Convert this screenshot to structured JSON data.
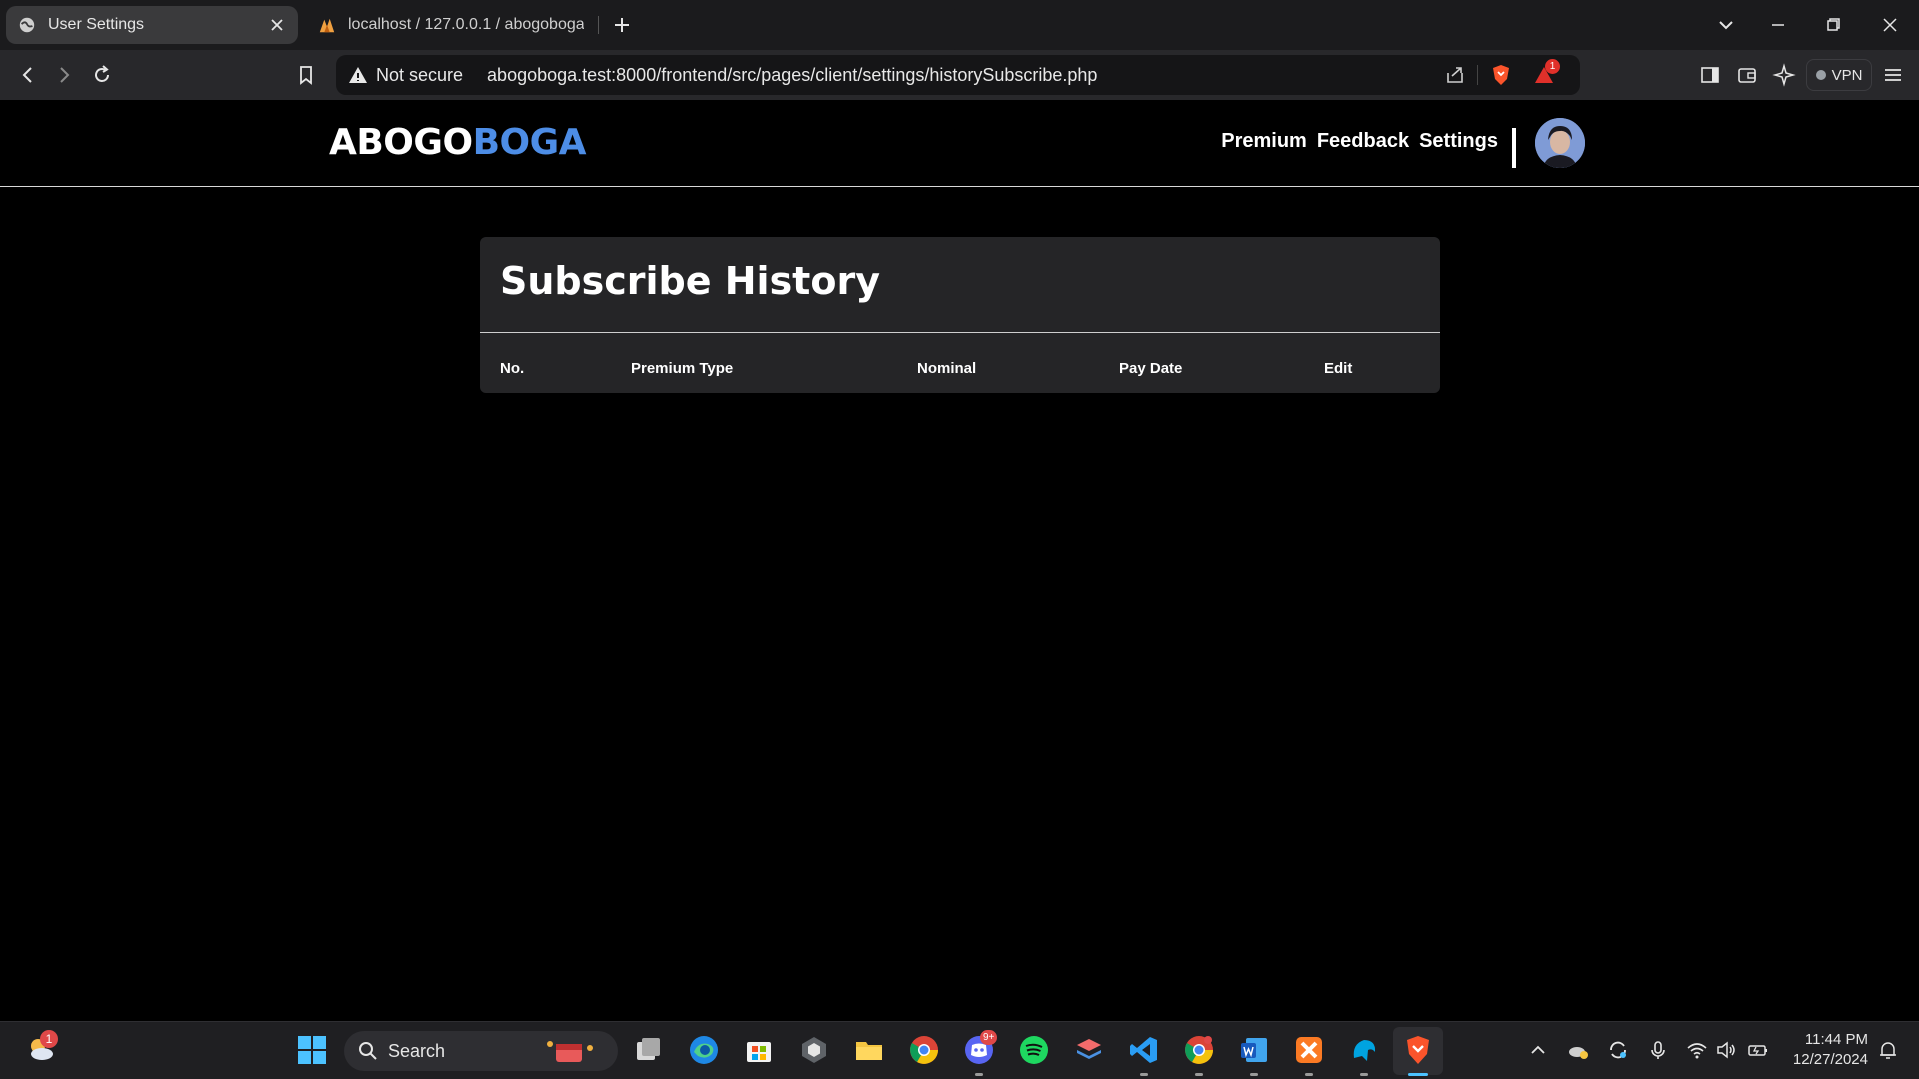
{
  "browser": {
    "tabs": [
      {
        "title": "User Settings",
        "active": true
      },
      {
        "title": "localhost / 127.0.0.1 / abogoboga /",
        "active": false
      }
    ],
    "not_secure_label": "Not secure",
    "url": "abogoboga.test:8000/frontend/src/pages/client/settings/historySubscribe.php",
    "vpn_label": "VPN",
    "shields_badge": "1"
  },
  "site": {
    "logo_part1": "ABOGO",
    "logo_part2": "BOGA",
    "nav": {
      "premium": "Premium",
      "feedback": "Feedback",
      "settings": "Settings"
    }
  },
  "card": {
    "title": "Subscribe History",
    "columns": [
      "No.",
      "Premium Type",
      "Nominal",
      "Pay Date",
      "Edit"
    ],
    "rows": []
  },
  "taskbar": {
    "search_placeholder": "Search",
    "weather_badge": "1",
    "discord_badge": "9+",
    "time": "11:44 PM",
    "date": "12/27/2024"
  },
  "colors": {
    "accent_blue": "#4d8de6",
    "card_bg": "#252527",
    "page_bg": "#000000"
  }
}
